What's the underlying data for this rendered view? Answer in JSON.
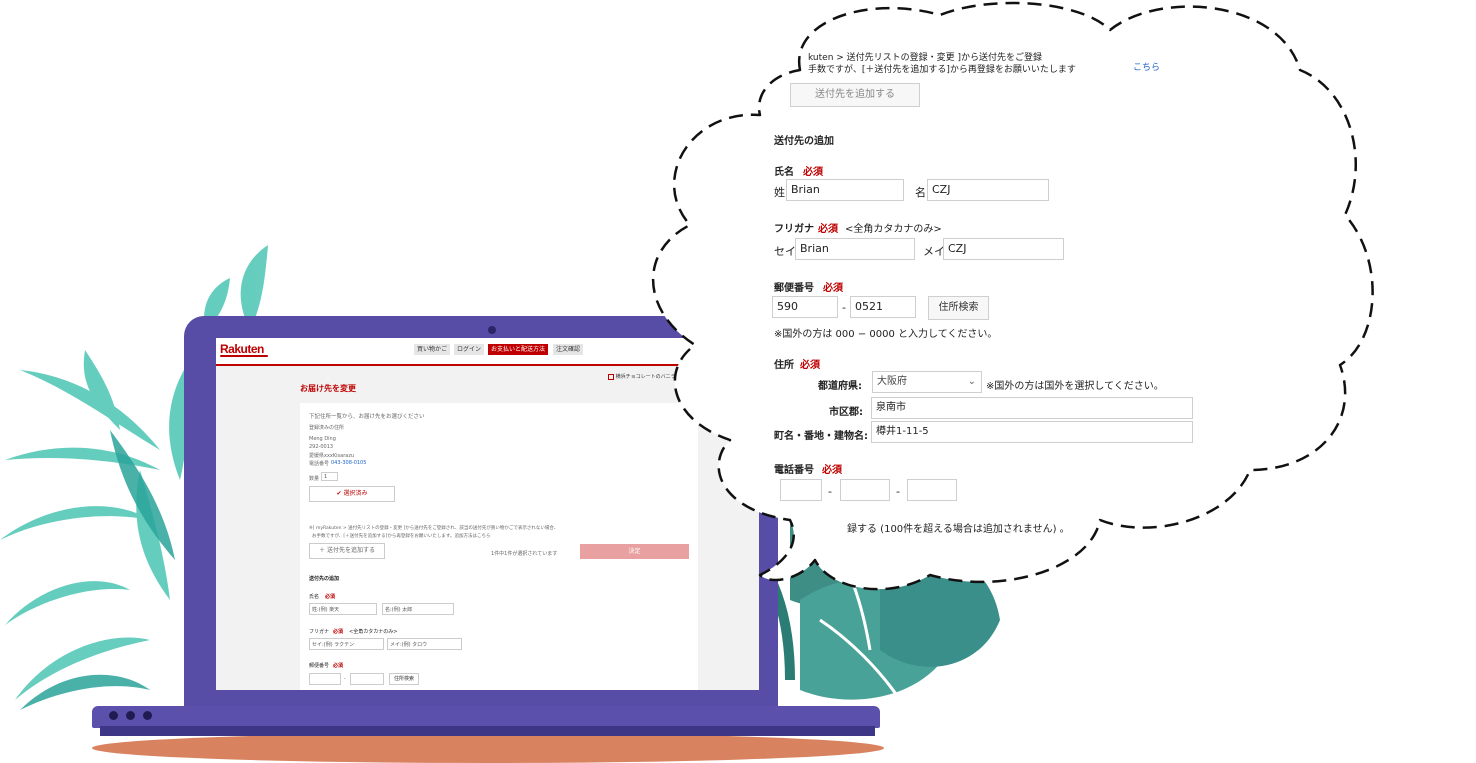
{
  "laptop_screen": {
    "logo": "Rakuten",
    "steps": [
      "買い物かご",
      "ログイン",
      "お支払いと配送方法",
      "注文確認"
    ],
    "page_title": "お届け先を変更",
    "shop_name": "横浜チョコレートのバニラビーンズ",
    "panel_intro": "下記住所一覧から、お届け先をお選びください",
    "registered_label": "登録済みの住所",
    "address_name": "Meng Ding",
    "address_postal": "292-0013",
    "address_city": "愛媛県xxxKisarazu",
    "address_phone_label": "電話番号",
    "address_phone": "043-308-0105",
    "quantity_label": "数量",
    "quantity_value": "1",
    "selected_button": "選択済み",
    "note_line1": "※[ myRakuten > 送付先リストの登録・変更 ]から送付先をご登録され、該当の送付先が買い物かごで表示されない場合、",
    "note_line2": "お手数ですが、[＋送付先を追加する]から再登録をお願いいたします。追加方法はこちら",
    "add_button": "＋ 送付先を追加する",
    "selected_count": "1件中1件が選択されています",
    "decide_button": "決定",
    "add_section": "送付先の追加",
    "name_label": "氏名",
    "required": "必須",
    "last_name_placeholder": "姓:(例) 楽天",
    "first_name_placeholder": "名:(例) 太郎",
    "kana_label": "フリガナ",
    "kana_note": "<全角カタカナのみ>",
    "sei_placeholder": "セイ:(例) ラクテン",
    "mei_placeholder": "メイ:(例) タロウ",
    "postal_label": "郵便番号",
    "postal_search": "住所検索"
  },
  "zoom_bubble": {
    "top_line1": "kuten > 送付先リストの登録・変更 ]から送付先をご登録",
    "top_line2": "手数ですが、[＋送付先を追加する]から再登録をお願いいたします",
    "top_link": "こちら",
    "add_button": "送付先を追加する",
    "add_section": "送付先の追加",
    "name_label": "氏名",
    "required": "必須",
    "last_name_prefix": "姓:",
    "last_name_value": "Brian",
    "first_name_prefix": "名:",
    "first_name_value": "CZJ",
    "kana_label": "フリガナ",
    "kana_note": "<全角カタカナのみ>",
    "sei_prefix": "セイ:",
    "sei_value": "Brian",
    "mei_prefix": "メイ:",
    "mei_value": "CZJ",
    "postal_label": "郵便番号",
    "postal1": "590",
    "postal_dash": "-",
    "postal2": "0521",
    "postal_search": "住所検索",
    "postal_note": "※国外の方は 000 − 0000 と入力してください。",
    "address_label": "住所",
    "prefecture_label": "都道府県:",
    "prefecture_value": "大阪府",
    "prefecture_note": "※国外の方は国外を選択してください。",
    "city_label": "市区郡:",
    "city_value": "泉南市",
    "street_label": "町名・番地・建物名:",
    "street_value": "樽井1-11-5",
    "phone_label": "電話番号",
    "phone_dash": "-",
    "bottom_text": "録する (100件を超える場合は追加されません) 。"
  },
  "colors": {
    "laptop": "#574ca6",
    "rakuten_red": "#bf0000",
    "leaf_teal": "#4fc3b5",
    "leaf_dark": "#3a8f8a",
    "shadow": "#d8825f"
  }
}
